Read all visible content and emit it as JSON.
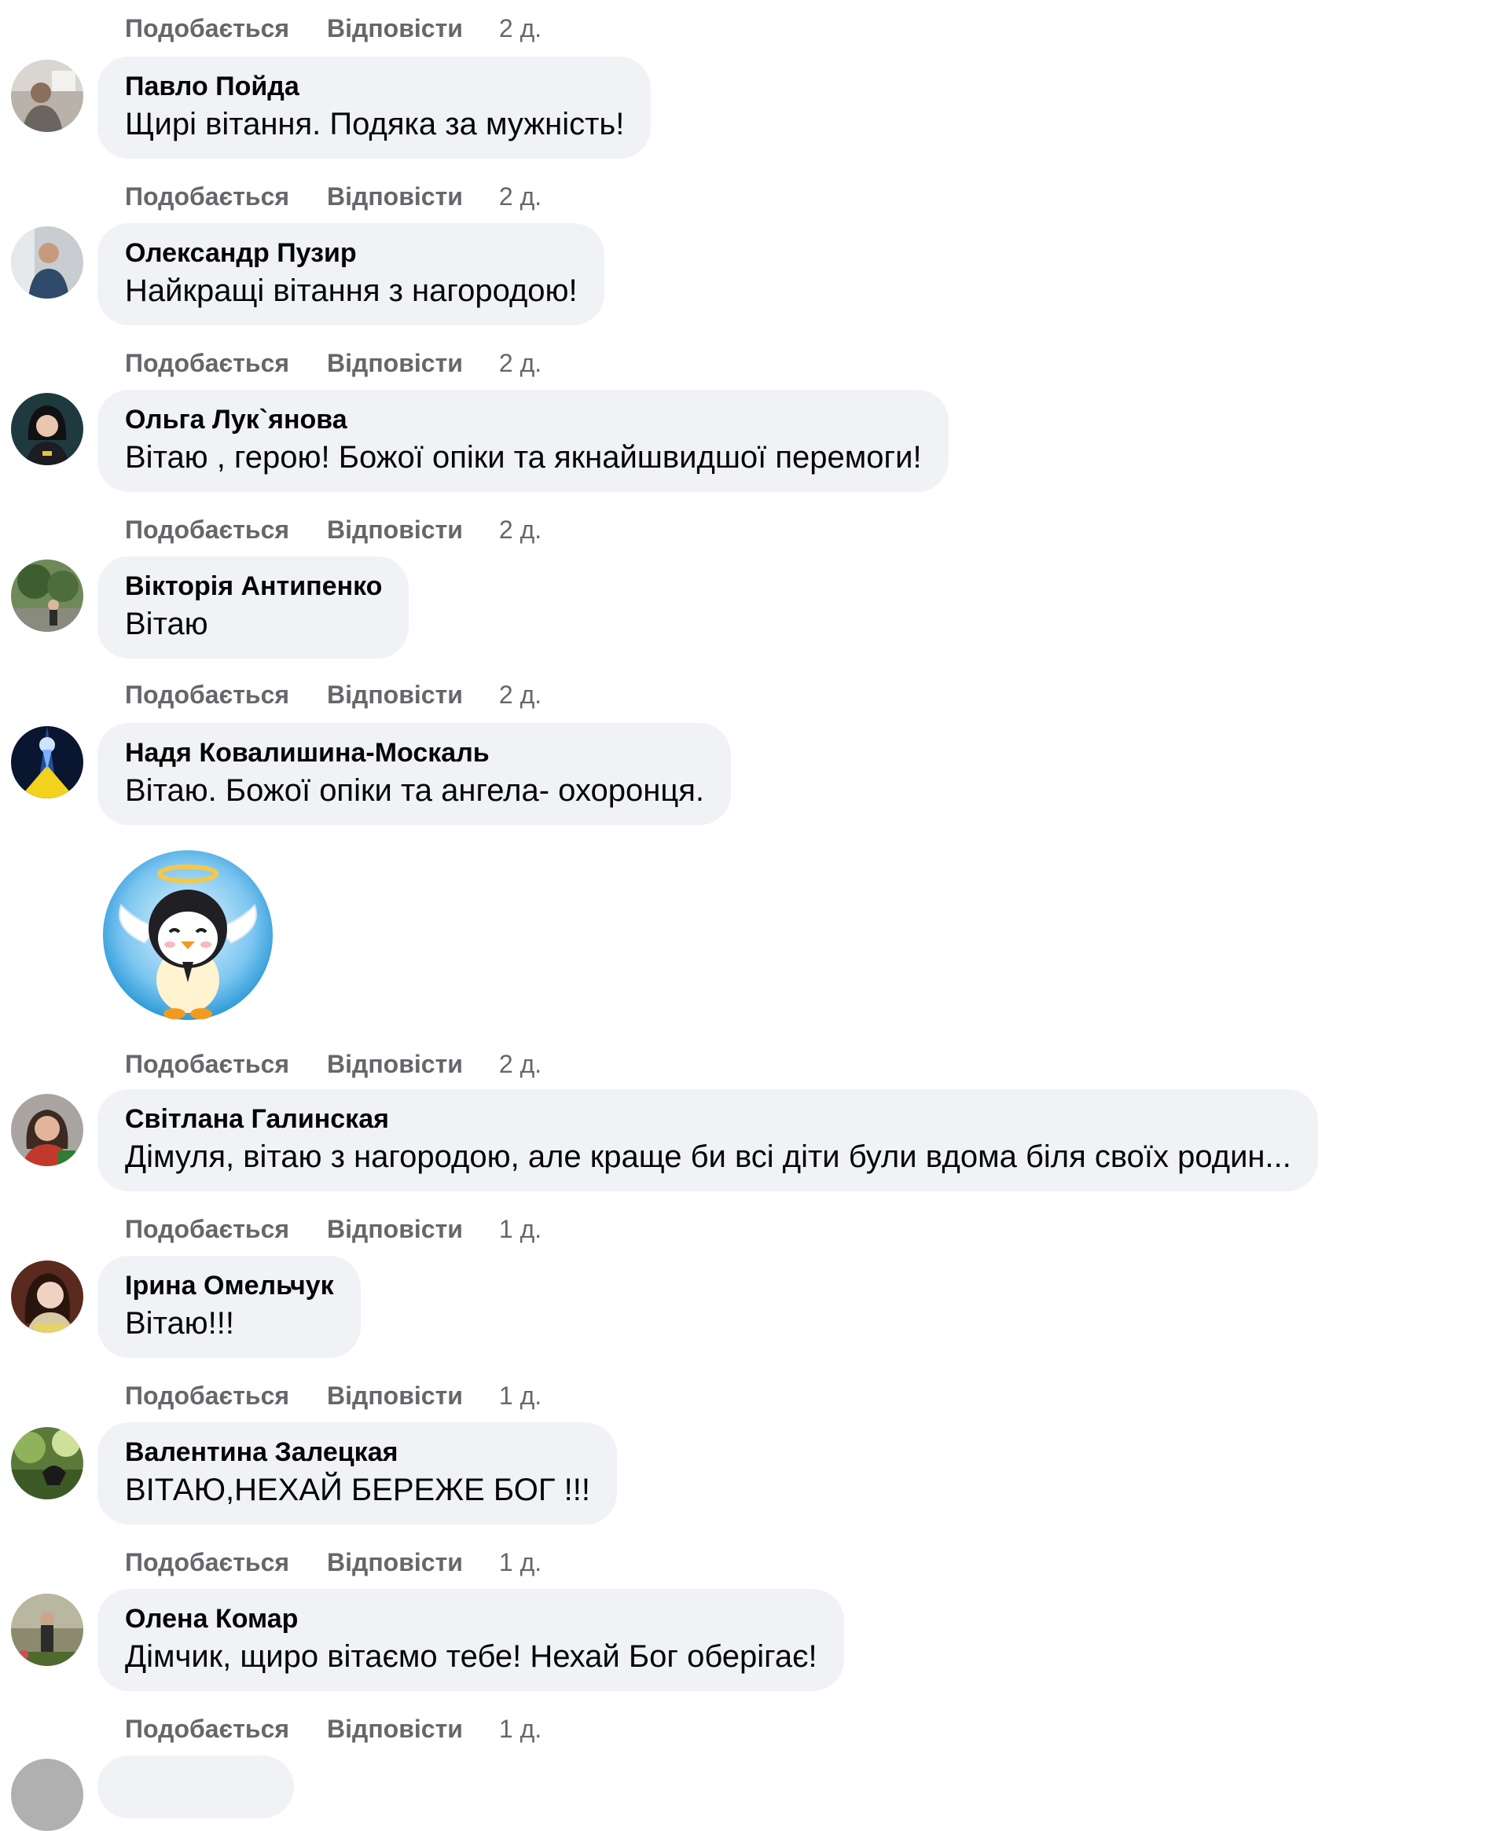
{
  "actions": {
    "like_label": "Подобається",
    "reply_label": "Відповісти"
  },
  "comments": [
    {
      "author": "Павло Пойда",
      "text": "Щирі вітання. Подяка за мужність!",
      "time": "2 д."
    },
    {
      "author": "Олександр Пузир",
      "text": "Найкращі вітання з нагородою!",
      "time": "2 д."
    },
    {
      "author": "Ольга Лук`янова",
      "text": "Вітаю , герою! Божої опіки та якнайшвидшої перемоги!",
      "time": "2 д."
    },
    {
      "author": "Вікторія Антипенко",
      "text": "Вітаю",
      "time": "2 д."
    },
    {
      "author": "Надя Ковалишина-Москаль",
      "text": "Вітаю. Божої опіки та ангела- охоронця.",
      "time": "2 д.",
      "sticker": "angel-penguin-sticker"
    },
    {
      "author": "Світлана Галинская",
      "text": "Дімуля, вітаю з нагородою, але краще би всі діти були вдома біля своїх родин...",
      "time": "1 д."
    },
    {
      "author": "Ірина Омельчук",
      "text": "Вітаю!!!",
      "time": "1 д."
    },
    {
      "author": "Валентина Залецкая",
      "text": "ВІТАЮ,НЕХАЙ БЕРЕЖЕ БОГ !!!",
      "time": "1 д."
    },
    {
      "author": "Олена Комар",
      "text": "Дімчик, щиро вітаємо тебе! Нехай Бог оберігає!",
      "time": "1 д."
    }
  ],
  "top_meta": {
    "time": "2 д."
  },
  "colors": {
    "bubble": "#f0f2f5",
    "meta_text": "#65676b",
    "body_text": "#050505"
  }
}
